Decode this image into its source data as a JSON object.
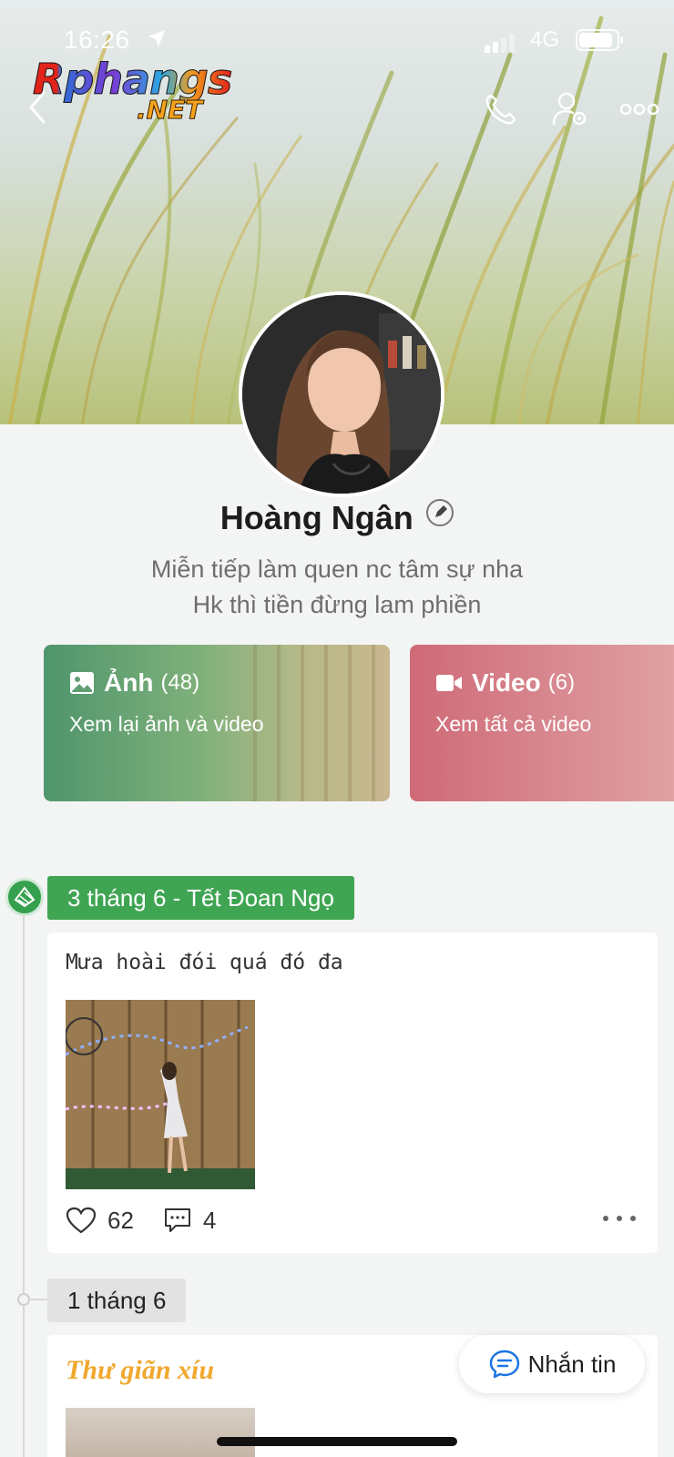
{
  "status_bar": {
    "time": "16:26",
    "network": "4G",
    "battery_level": 0.85
  },
  "watermark": {
    "brand": "Rphangs",
    "domain": ".NET"
  },
  "header": {
    "back_icon": "chevron-left-icon",
    "call_icon": "phone-icon",
    "settings_icon": "user-gear-icon",
    "more_icon": "more-horizontal-icon"
  },
  "profile": {
    "name": "Hoàng Ngân",
    "bio_line1": "Miễn tiếp làm quen nc tâm sự nha",
    "bio_line2": "Hk thì tiền đừng lam phiền"
  },
  "albums": {
    "photos": {
      "title": "Ảnh",
      "count": "(48)",
      "subtitle": "Xem lại ảnh và video",
      "color": "#4f956c"
    },
    "video": {
      "title": "Video",
      "count": "(6)",
      "subtitle": "Xem tất cả video",
      "color": "#cf6a77"
    }
  },
  "timeline": [
    {
      "date": "3 tháng 6 - Tết Đoan Ngọ",
      "text": "Mưa hoài đói quá đó đa",
      "likes": "62",
      "comments": "4"
    },
    {
      "date": "1 tháng 6",
      "text": "Thư giãn xíu"
    }
  ],
  "message_button": {
    "label": "Nhắn tin"
  },
  "colors": {
    "accent_green": "#3fa553",
    "accent_orange": "#f0a82e",
    "accent_blue": "#1b74e4"
  }
}
